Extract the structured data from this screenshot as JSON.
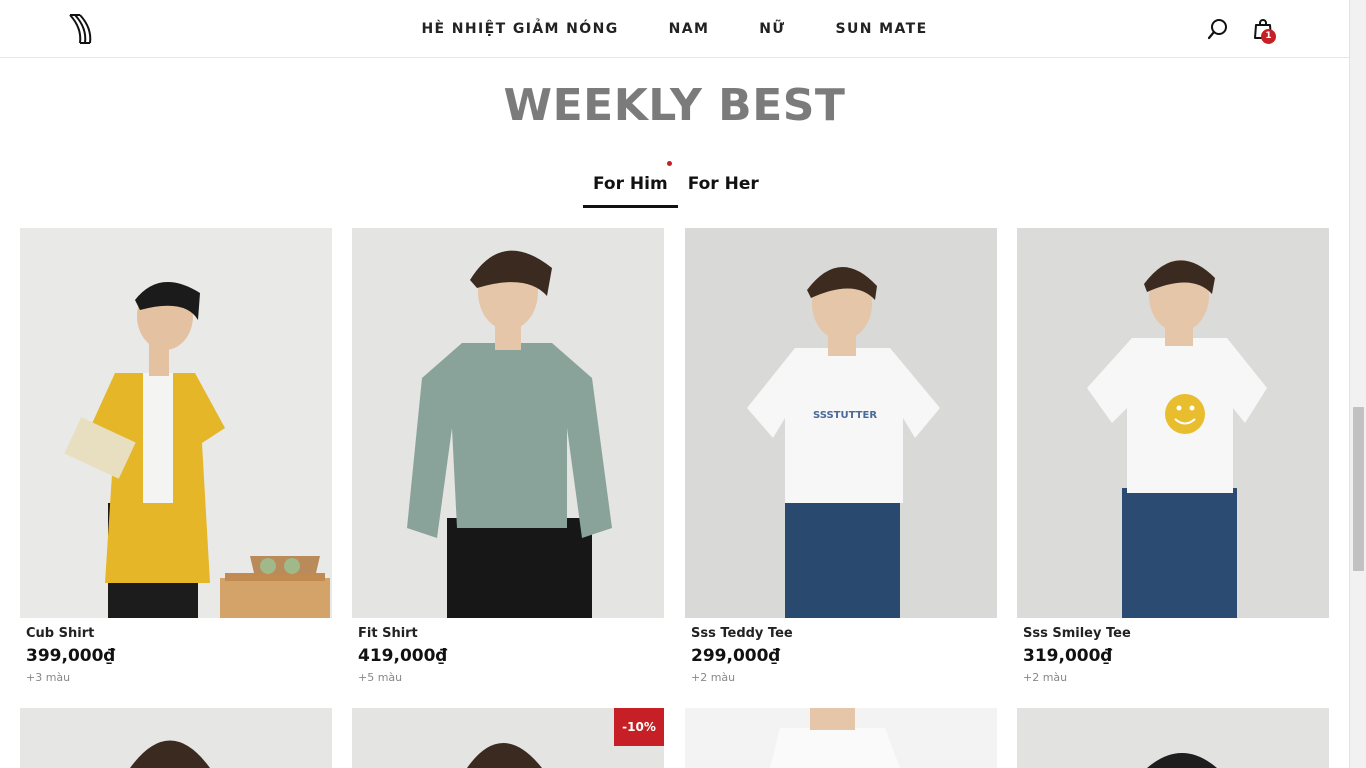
{
  "header": {
    "nav": [
      "HÈ NHIỆT GIẢM NÓNG",
      "NAM",
      "NỮ",
      "SUN MATE"
    ],
    "cart_count": "1"
  },
  "section": {
    "title": "WEEKLY BEST",
    "tabs": [
      "For Him",
      "For Her"
    ]
  },
  "products": [
    {
      "name": "Cub Shirt",
      "price": "399,000₫",
      "colors": "+3 màu",
      "shirt": "#e5b628",
      "pants": "#1c1c1c",
      "bg": "#e9e9e7"
    },
    {
      "name": "Fit Shirt",
      "price": "419,000₫",
      "colors": "+5 màu",
      "shirt": "#8aa39a",
      "pants": "#171717",
      "bg": "#e4e4e2"
    },
    {
      "name": "Sss Teddy Tee",
      "price": "299,000₫",
      "colors": "+2 màu",
      "shirt": "#f7f7f7",
      "pants": "#29496e",
      "bg": "#d9d9d8"
    },
    {
      "name": "Sss Smiley Tee",
      "price": "319,000₫",
      "colors": "+2 màu",
      "shirt": "#f7f7f7",
      "pants": "#2b4b72",
      "bg": "#dbdbda"
    }
  ],
  "row2": [
    {
      "badge": ""
    },
    {
      "badge": "-10%"
    },
    {
      "badge": ""
    },
    {
      "badge": ""
    }
  ],
  "colors": {
    "accent": "#c62026",
    "title": "#7b7b7b"
  }
}
